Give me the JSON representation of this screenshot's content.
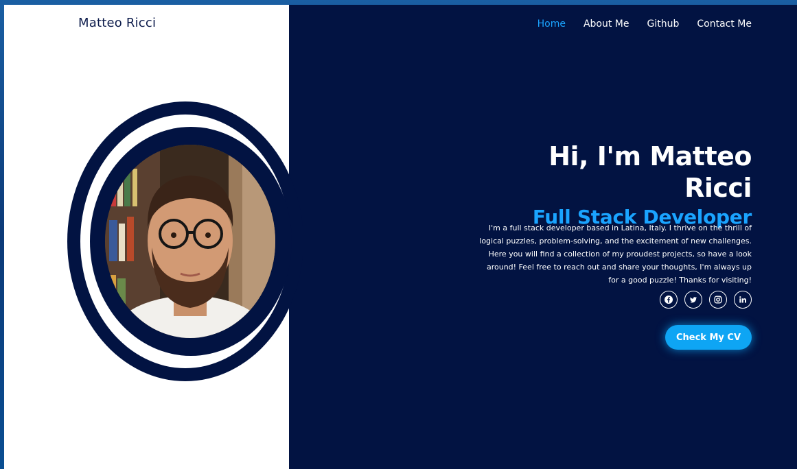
{
  "header": {
    "brand": "Matteo Ricci",
    "nav": [
      {
        "label": "Home",
        "active": true
      },
      {
        "label": "About Me",
        "active": false
      },
      {
        "label": "Github",
        "active": false
      },
      {
        "label": "Contact Me",
        "active": false
      }
    ]
  },
  "hero": {
    "greeting": "Hi, I'm Matteo Ricci",
    "role": "Full Stack Developer",
    "bio": "I'm a full stack developer based in Latina, Italy. I thrive on the thrill of logical puzzles, problem-solving, and the excitement of new challenges. Here you will find a collection of my proudest projects, so have a look around! Feel free to reach out and share your thoughts, I'm always up for a good puzzle! Thanks for visiting!",
    "cv_button": "Check My CV"
  },
  "socials": [
    {
      "icon": "facebook-icon"
    },
    {
      "icon": "twitter-icon"
    },
    {
      "icon": "instagram-icon"
    },
    {
      "icon": "linkedin-icon"
    }
  ],
  "colors": {
    "navy": "#021342",
    "accent": "#1aa4ff",
    "button": "#0ea5f4",
    "white": "#ffffff"
  },
  "portrait": {
    "description": "profile photo"
  }
}
